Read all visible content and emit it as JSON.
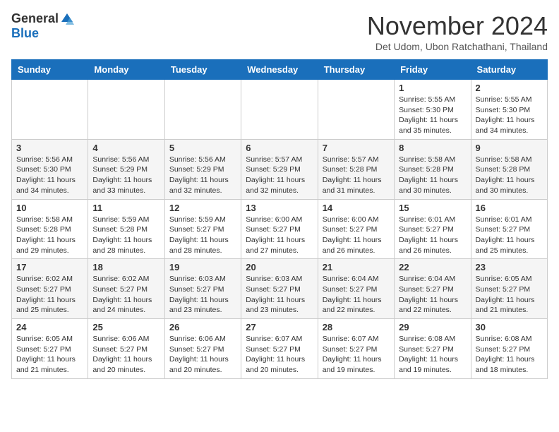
{
  "header": {
    "logo_general": "General",
    "logo_blue": "Blue",
    "month_title": "November 2024",
    "location": "Det Udom, Ubon Ratchathani, Thailand"
  },
  "days_of_week": [
    "Sunday",
    "Monday",
    "Tuesday",
    "Wednesday",
    "Thursday",
    "Friday",
    "Saturday"
  ],
  "weeks": [
    [
      {
        "day": "",
        "info": ""
      },
      {
        "day": "",
        "info": ""
      },
      {
        "day": "",
        "info": ""
      },
      {
        "day": "",
        "info": ""
      },
      {
        "day": "",
        "info": ""
      },
      {
        "day": "1",
        "info": "Sunrise: 5:55 AM\nSunset: 5:30 PM\nDaylight: 11 hours\nand 35 minutes."
      },
      {
        "day": "2",
        "info": "Sunrise: 5:55 AM\nSunset: 5:30 PM\nDaylight: 11 hours\nand 34 minutes."
      }
    ],
    [
      {
        "day": "3",
        "info": "Sunrise: 5:56 AM\nSunset: 5:30 PM\nDaylight: 11 hours\nand 34 minutes."
      },
      {
        "day": "4",
        "info": "Sunrise: 5:56 AM\nSunset: 5:29 PM\nDaylight: 11 hours\nand 33 minutes."
      },
      {
        "day": "5",
        "info": "Sunrise: 5:56 AM\nSunset: 5:29 PM\nDaylight: 11 hours\nand 32 minutes."
      },
      {
        "day": "6",
        "info": "Sunrise: 5:57 AM\nSunset: 5:29 PM\nDaylight: 11 hours\nand 32 minutes."
      },
      {
        "day": "7",
        "info": "Sunrise: 5:57 AM\nSunset: 5:28 PM\nDaylight: 11 hours\nand 31 minutes."
      },
      {
        "day": "8",
        "info": "Sunrise: 5:58 AM\nSunset: 5:28 PM\nDaylight: 11 hours\nand 30 minutes."
      },
      {
        "day": "9",
        "info": "Sunrise: 5:58 AM\nSunset: 5:28 PM\nDaylight: 11 hours\nand 30 minutes."
      }
    ],
    [
      {
        "day": "10",
        "info": "Sunrise: 5:58 AM\nSunset: 5:28 PM\nDaylight: 11 hours\nand 29 minutes."
      },
      {
        "day": "11",
        "info": "Sunrise: 5:59 AM\nSunset: 5:28 PM\nDaylight: 11 hours\nand 28 minutes."
      },
      {
        "day": "12",
        "info": "Sunrise: 5:59 AM\nSunset: 5:27 PM\nDaylight: 11 hours\nand 28 minutes."
      },
      {
        "day": "13",
        "info": "Sunrise: 6:00 AM\nSunset: 5:27 PM\nDaylight: 11 hours\nand 27 minutes."
      },
      {
        "day": "14",
        "info": "Sunrise: 6:00 AM\nSunset: 5:27 PM\nDaylight: 11 hours\nand 26 minutes."
      },
      {
        "day": "15",
        "info": "Sunrise: 6:01 AM\nSunset: 5:27 PM\nDaylight: 11 hours\nand 26 minutes."
      },
      {
        "day": "16",
        "info": "Sunrise: 6:01 AM\nSunset: 5:27 PM\nDaylight: 11 hours\nand 25 minutes."
      }
    ],
    [
      {
        "day": "17",
        "info": "Sunrise: 6:02 AM\nSunset: 5:27 PM\nDaylight: 11 hours\nand 25 minutes."
      },
      {
        "day": "18",
        "info": "Sunrise: 6:02 AM\nSunset: 5:27 PM\nDaylight: 11 hours\nand 24 minutes."
      },
      {
        "day": "19",
        "info": "Sunrise: 6:03 AM\nSunset: 5:27 PM\nDaylight: 11 hours\nand 23 minutes."
      },
      {
        "day": "20",
        "info": "Sunrise: 6:03 AM\nSunset: 5:27 PM\nDaylight: 11 hours\nand 23 minutes."
      },
      {
        "day": "21",
        "info": "Sunrise: 6:04 AM\nSunset: 5:27 PM\nDaylight: 11 hours\nand 22 minutes."
      },
      {
        "day": "22",
        "info": "Sunrise: 6:04 AM\nSunset: 5:27 PM\nDaylight: 11 hours\nand 22 minutes."
      },
      {
        "day": "23",
        "info": "Sunrise: 6:05 AM\nSunset: 5:27 PM\nDaylight: 11 hours\nand 21 minutes."
      }
    ],
    [
      {
        "day": "24",
        "info": "Sunrise: 6:05 AM\nSunset: 5:27 PM\nDaylight: 11 hours\nand 21 minutes."
      },
      {
        "day": "25",
        "info": "Sunrise: 6:06 AM\nSunset: 5:27 PM\nDaylight: 11 hours\nand 20 minutes."
      },
      {
        "day": "26",
        "info": "Sunrise: 6:06 AM\nSunset: 5:27 PM\nDaylight: 11 hours\nand 20 minutes."
      },
      {
        "day": "27",
        "info": "Sunrise: 6:07 AM\nSunset: 5:27 PM\nDaylight: 11 hours\nand 20 minutes."
      },
      {
        "day": "28",
        "info": "Sunrise: 6:07 AM\nSunset: 5:27 PM\nDaylight: 11 hours\nand 19 minutes."
      },
      {
        "day": "29",
        "info": "Sunrise: 6:08 AM\nSunset: 5:27 PM\nDaylight: 11 hours\nand 19 minutes."
      },
      {
        "day": "30",
        "info": "Sunrise: 6:08 AM\nSunset: 5:27 PM\nDaylight: 11 hours\nand 18 minutes."
      }
    ]
  ]
}
